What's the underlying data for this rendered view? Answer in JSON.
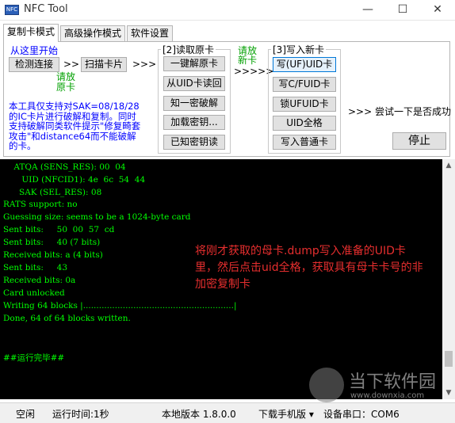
{
  "window": {
    "title": "NFC Tool",
    "icon_text": "NFC",
    "icon": "app-icon"
  },
  "controls": {
    "minimize": "—",
    "maximize": "☐",
    "close": "✕"
  },
  "tabs": [
    {
      "label": "复制卡模式",
      "active": true
    },
    {
      "label": "高级操作模式",
      "active": false
    },
    {
      "label": "软件设置",
      "active": false
    }
  ],
  "start": {
    "label": "从这里开始",
    "detect_button": "检测连接",
    "arrow1": ">>",
    "scan_button": "扫描卡片",
    "arrow2": ">>>",
    "place_hint": "请放\n原卡"
  },
  "read_group": {
    "title": "[2]读取原卡",
    "buttons": [
      "一键解原卡",
      "从UID卡读回",
      "知一密破解",
      "加载密钥...",
      "已知密钥读"
    ]
  },
  "middle": {
    "hint": "请放\n新卡",
    "arrows": ">>>>>"
  },
  "write_group": {
    "title": "[3]写入新卡",
    "buttons": [
      "写(UF)UID卡",
      "写C/FUID卡",
      "锁UFUID卡",
      "UID全格",
      "写入普通卡"
    ]
  },
  "try_hint": ">>> 尝试一下是否成功",
  "stop_button": "停止",
  "description": "本工具仅支持对SAK=08/18/28的IC卡片进行破解和复制。同时支持破解同类软件提示\"修复畸套攻击\"和distance64而不能破解的卡。",
  "console": {
    "lines": [
      "    ATQA (SENS_RES): 00  04",
      "       UID (NFCID1): 4e  6c  54  44",
      "      SAK (SEL_RES): 08",
      "RATS support: no",
      "Guessing size: seems to be a 1024-byte card",
      "Sent bits:     50  00  57  cd",
      "Sent bits:     40 (7 bits)",
      "Received bits: a (4 bits)",
      "Sent bits:     43",
      "Received bits: 0a",
      "Card unlocked",
      "Writing 64 blocks |.........................................................|",
      "Done, 64 of 64 blocks written.",
      "",
      "",
      "##运行完毕##"
    ],
    "annotation": "将刚才获取的母卡.dump写入准备的UID卡里，然后点击uid全格，获取具有母卡卡号的非加密复制卡"
  },
  "watermark": {
    "text": "当下软件园",
    "url": "www.downxia.com"
  },
  "status": {
    "state": "空闲",
    "runtime": "运行时间:1秒",
    "version": "本地版本 1.8.0.0",
    "download": "下载手机版 ▾",
    "device": "设备串口：COM6"
  }
}
